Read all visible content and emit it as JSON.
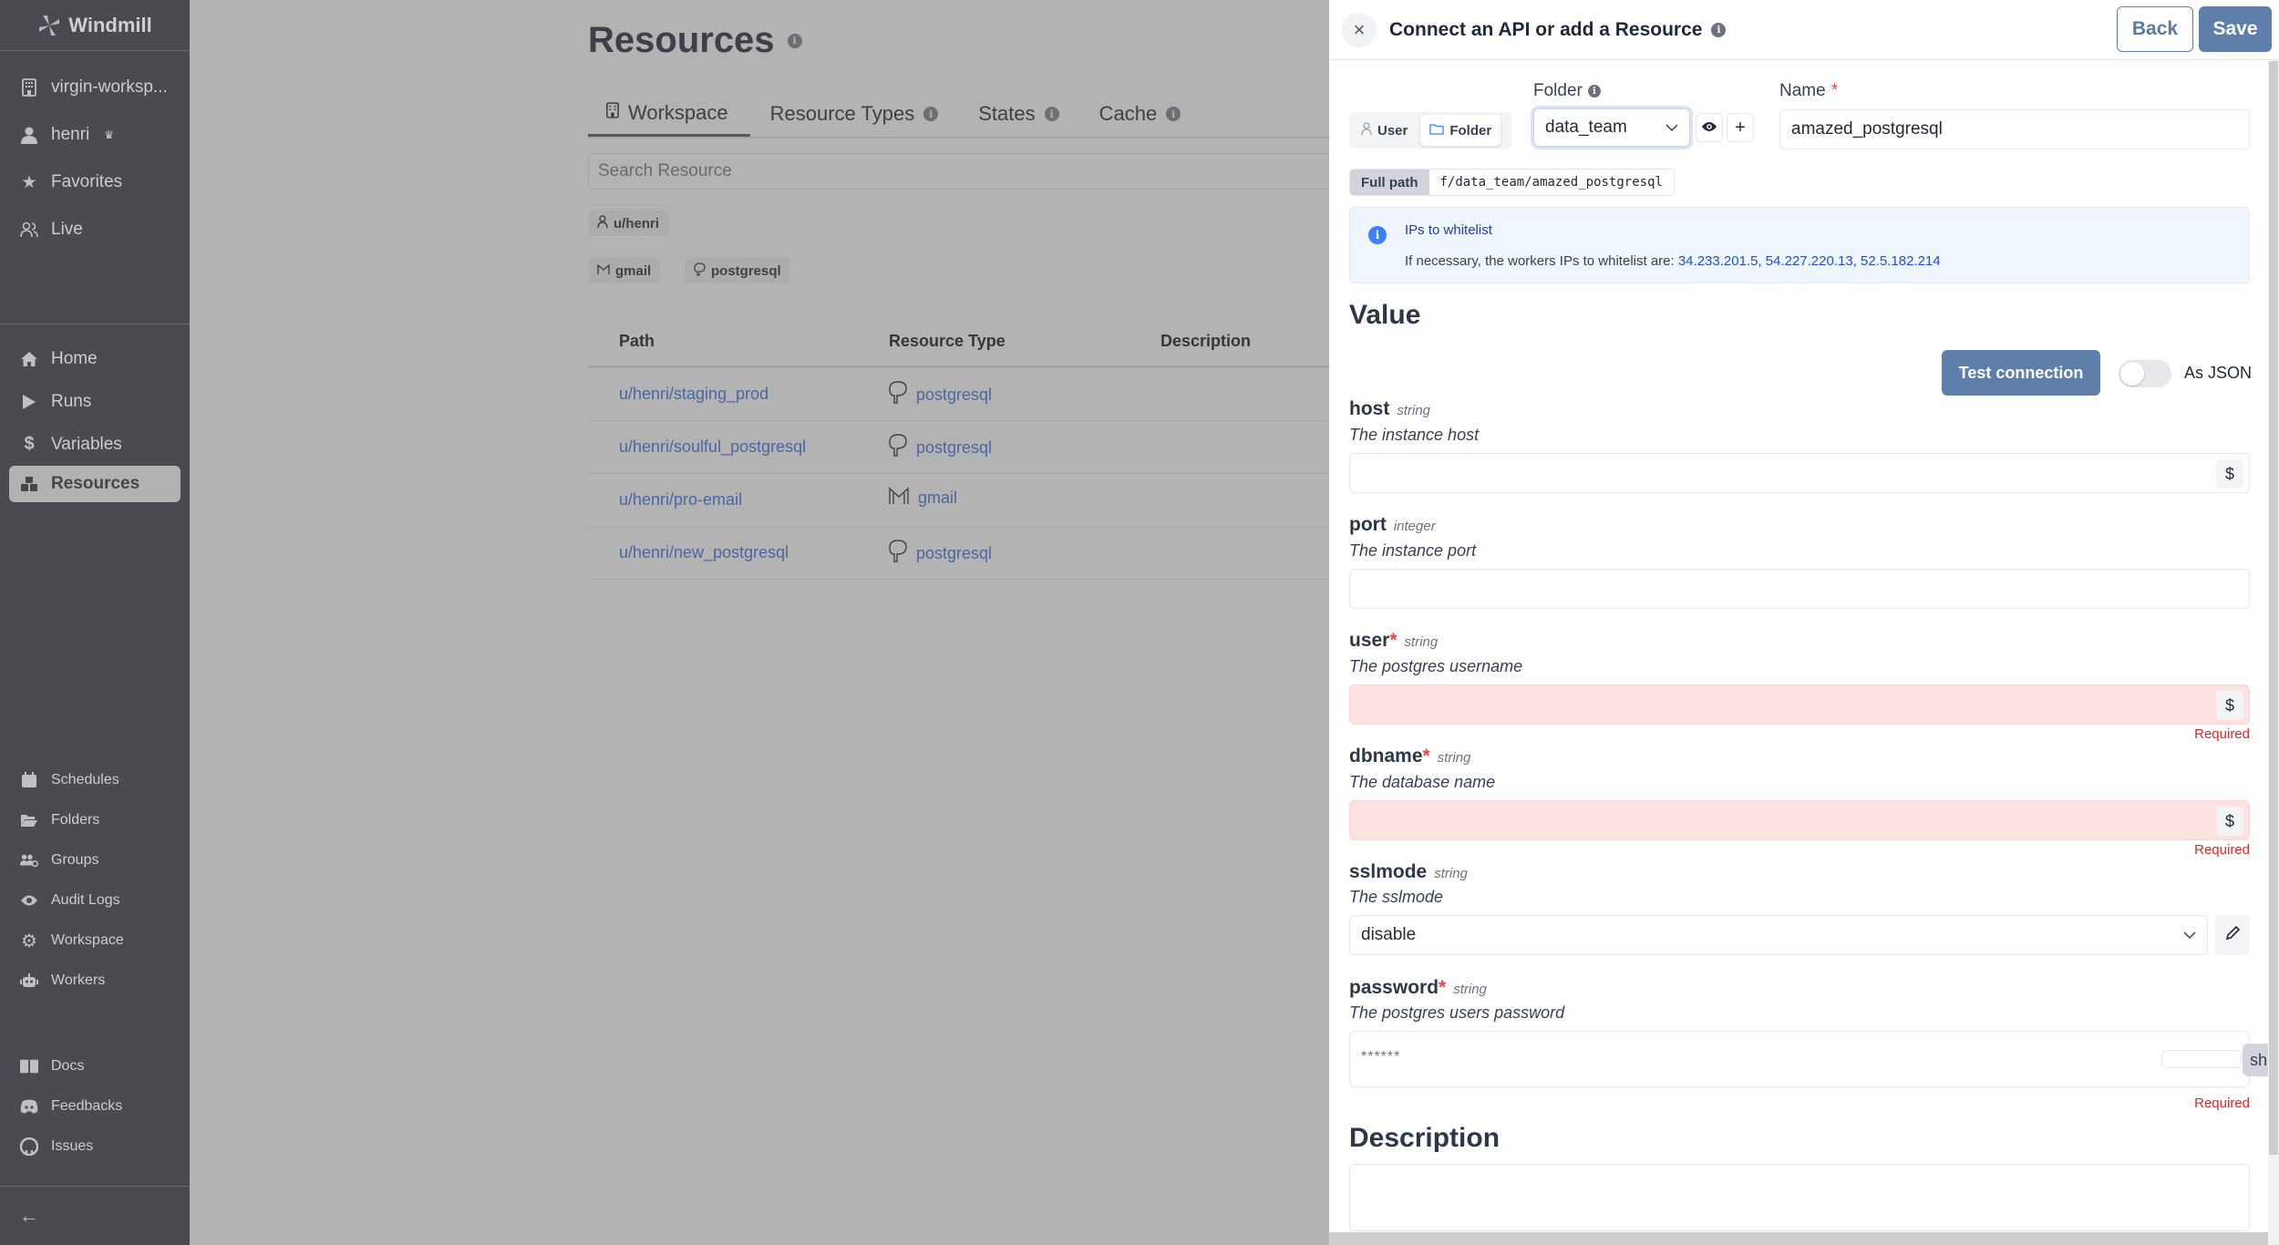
{
  "sidebar": {
    "brand": "Windmill",
    "top_items": [
      {
        "label": "virgin-worksp...",
        "icon": "building-icon"
      },
      {
        "label": "henri",
        "icon": "user-icon",
        "badge": "crown-icon"
      },
      {
        "label": "Favorites",
        "icon": "star-icon"
      },
      {
        "label": "Live",
        "icon": "users-icon"
      }
    ],
    "main_items": [
      {
        "label": "Home",
        "icon": "home-icon"
      },
      {
        "label": "Runs",
        "icon": "play-icon"
      },
      {
        "label": "Variables",
        "icon": "dollar-icon"
      },
      {
        "label": "Resources",
        "icon": "boxes-icon",
        "active": true
      }
    ],
    "admin_items": [
      {
        "label": "Schedules",
        "icon": "calendar-icon"
      },
      {
        "label": "Folders",
        "icon": "folder-open-icon"
      },
      {
        "label": "Groups",
        "icon": "users-cog-icon"
      },
      {
        "label": "Audit Logs",
        "icon": "eye-icon"
      },
      {
        "label": "Workspace",
        "icon": "gear-icon"
      },
      {
        "label": "Workers",
        "icon": "robot-icon"
      }
    ],
    "help_items": [
      {
        "label": "Docs",
        "icon": "book-icon"
      },
      {
        "label": "Feedbacks",
        "icon": "discord-icon"
      },
      {
        "label": "Issues",
        "icon": "github-icon"
      }
    ],
    "collapse_icon": "arrow-left-icon"
  },
  "main": {
    "title": "Resources",
    "tabs": [
      {
        "label": "Workspace",
        "active": true,
        "icon": "building-icon"
      },
      {
        "label": "Resource Types",
        "info": true
      },
      {
        "label": "States",
        "info": true
      },
      {
        "label": "Cache",
        "info": true
      }
    ],
    "search_placeholder": "Search Resource",
    "owner_filters": [
      "u/henri"
    ],
    "type_filters": [
      "gmail",
      "postgresql"
    ],
    "table": {
      "columns": [
        "Path",
        "Resource Type",
        "Description"
      ],
      "rows": [
        {
          "path": "u/henri/staging_prod",
          "type": "postgresql"
        },
        {
          "path": "u/henri/soulful_postgresql",
          "type": "postgresql"
        },
        {
          "path": "u/henri/pro-email",
          "type": "gmail"
        },
        {
          "path": "u/henri/new_postgresql",
          "type": "postgresql"
        }
      ]
    }
  },
  "drawer": {
    "title": "Connect an API or add a Resource",
    "back_label": "Back",
    "save_label": "Save",
    "owner_toggle": {
      "options": [
        "User",
        "Folder"
      ],
      "selected": "Folder"
    },
    "folder_label": "Folder",
    "folder_value": "data_team",
    "name_label": "Name",
    "name_value": "amazed_postgresql",
    "full_path_label": "Full path",
    "full_path_value": "f/data_team/amazed_postgresql",
    "alert": {
      "title": "IPs to whitelist",
      "body": "If necessary, the workers IPs to whitelist are: ",
      "ips": "34.233.201.5, 54.227.220.13, 52.5.182.214"
    },
    "value_heading": "Value",
    "test_connection_label": "Test connection",
    "as_json_label": "As JSON",
    "as_json_enabled": false,
    "fields": [
      {
        "name": "host",
        "type": "string",
        "description": "The instance host",
        "required": false,
        "value": ""
      },
      {
        "name": "port",
        "type": "integer",
        "description": "The instance port",
        "required": false,
        "value": ""
      },
      {
        "name": "user",
        "type": "string",
        "description": "The postgres username",
        "required": true,
        "value": "",
        "error": "Required"
      },
      {
        "name": "dbname",
        "type": "string",
        "description": "The database name",
        "required": true,
        "value": "",
        "error": "Required"
      },
      {
        "name": "sslmode",
        "type": "string",
        "description": "The sslmode",
        "required": false,
        "value": "disable"
      },
      {
        "name": "password",
        "type": "string",
        "description": "The postgres users password",
        "required": true,
        "value": "******",
        "error": "Required",
        "show_label": "sh"
      }
    ],
    "description_heading": "Description",
    "description_value": "",
    "required_marker": "*"
  }
}
